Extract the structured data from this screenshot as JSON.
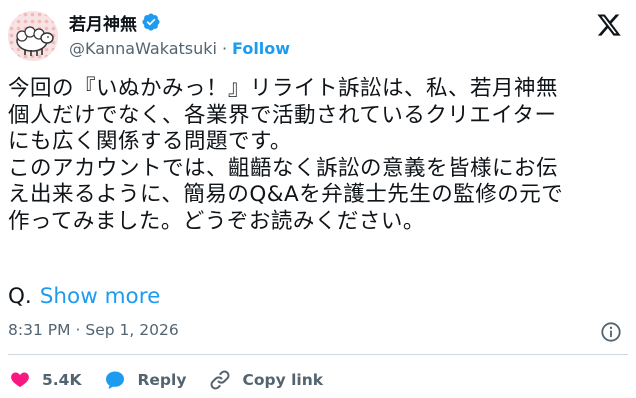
{
  "author": {
    "display_name": "若月神無",
    "handle": "@KannaWakatsuki",
    "separator": "·",
    "follow_label": "Follow",
    "verified_color": "#1d9bf0"
  },
  "tweet": {
    "lines": [
      "今回の『いぬかみっ！』リライト訴訟は、私、若月神無",
      "個人だけでなく、各業界で活動されているクリエイター",
      "にも広く関係する問題です。",
      "このアカウントでは、齟齬なく訴訟の意義を皆様にお伝",
      "え出来るように、簡易のQ&Aを弁護士先生の監修の元で",
      "作ってみました。どうぞお読みください。"
    ],
    "q_prefix": "Q.",
    "show_more": "Show more"
  },
  "meta": {
    "time": "8:31 PM",
    "separator": "·",
    "date": "Sep 1, 2026"
  },
  "actions": {
    "like_count": "5.4K",
    "reply_label": "Reply",
    "copy_link_label": "Copy link"
  },
  "icons": {
    "avatar": "sheep-avatar-icon",
    "verified": "verified-badge-icon",
    "logo": "x-logo-icon",
    "info": "info-icon",
    "like": "heart-icon",
    "reply": "reply-bubble-icon",
    "copy_link": "link-icon"
  },
  "colors": {
    "accent": "#1d9bf0",
    "like": "#f91880",
    "text": "#0f1419",
    "muted": "#536471",
    "divider": "#cfd9de"
  }
}
